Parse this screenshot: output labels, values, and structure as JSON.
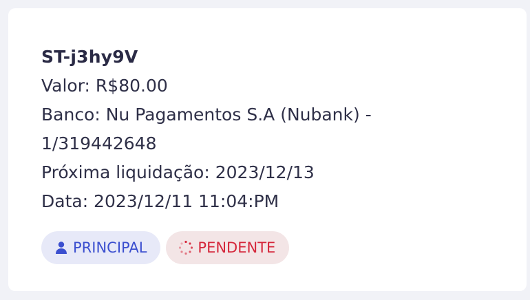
{
  "card": {
    "id": "ST-j3hy9V",
    "valor": "Valor: R$80.00",
    "banco_line1": "Banco: Nu Pagamentos S.A (Nubank) -",
    "banco_line2": "1/319442648",
    "proxima": "Próxima liquidação: 2023/12/13",
    "data": "Data: 2023/12/11 11:04:PM"
  },
  "badges": {
    "principal": {
      "label": "PRINCIPAL",
      "icon": "user-icon",
      "color": "#3b4fcf",
      "background": "#e7e9f8"
    },
    "pendente": {
      "label": "PENDENTE",
      "icon": "spinner-icon",
      "color": "#d5263a",
      "background": "#f3e5e6"
    }
  }
}
